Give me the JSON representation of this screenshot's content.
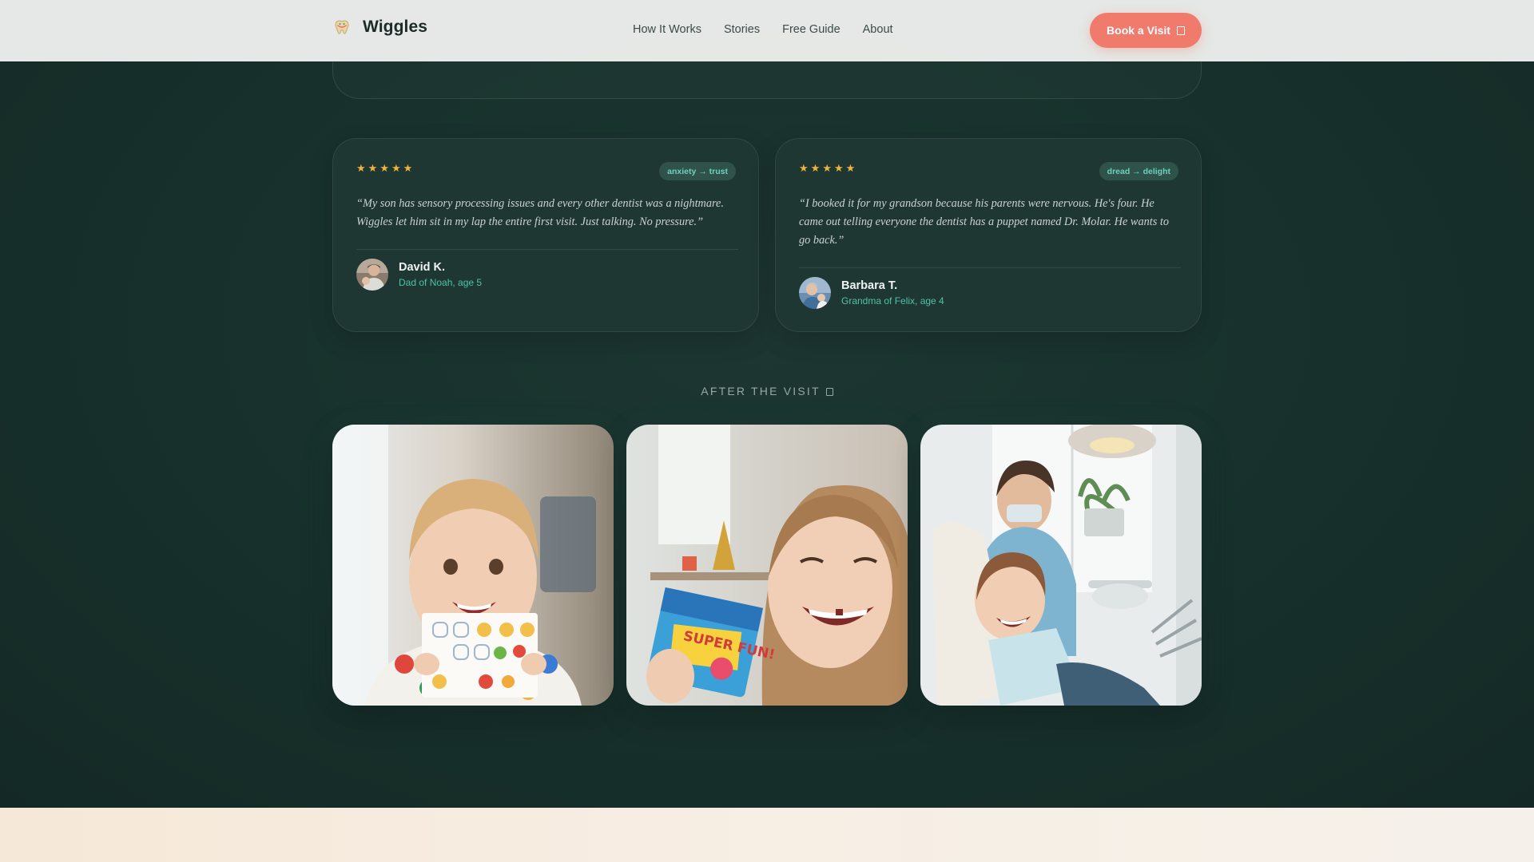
{
  "nav": {
    "brand": "Wiggles",
    "links": [
      "How It Works",
      "Stories",
      "Free Guide",
      "About"
    ],
    "cta_label": "Book a Visit"
  },
  "reviews": [
    {
      "stars": 5,
      "tag": "anxiety → trust",
      "quote": "“My son has sensory processing issues and every other dentist was a nightmare. Wiggles let him sit in my lap the entire first visit. Just talking. No pressure.”",
      "name": "David K.",
      "role": "Dad of Noah, age 5"
    },
    {
      "stars": 5,
      "tag": "dread → delight",
      "quote": "“I booked it for my grandson because his parents were nervous. He's four. He came out telling everyone the dentist has a puppet named Dr. Molar. He wants to go back.”",
      "name": "Barbara T.",
      "role": "Grandma of Felix, age 4"
    }
  ],
  "after_visit": {
    "label": "AFTER THE VISIT",
    "photos": [
      {
        "icon": "child-with-sticker-sheet-photo"
      },
      {
        "icon": "girl-with-toy-box-photo",
        "box_text": "SUPER FUN!"
      },
      {
        "icon": "girl-in-dental-chair-photo"
      }
    ]
  },
  "colors": {
    "background": "#17302b",
    "card": "#1f3732",
    "accent": "#f07a6c",
    "teal": "#4fc2a8",
    "star": "#f2b33d"
  }
}
